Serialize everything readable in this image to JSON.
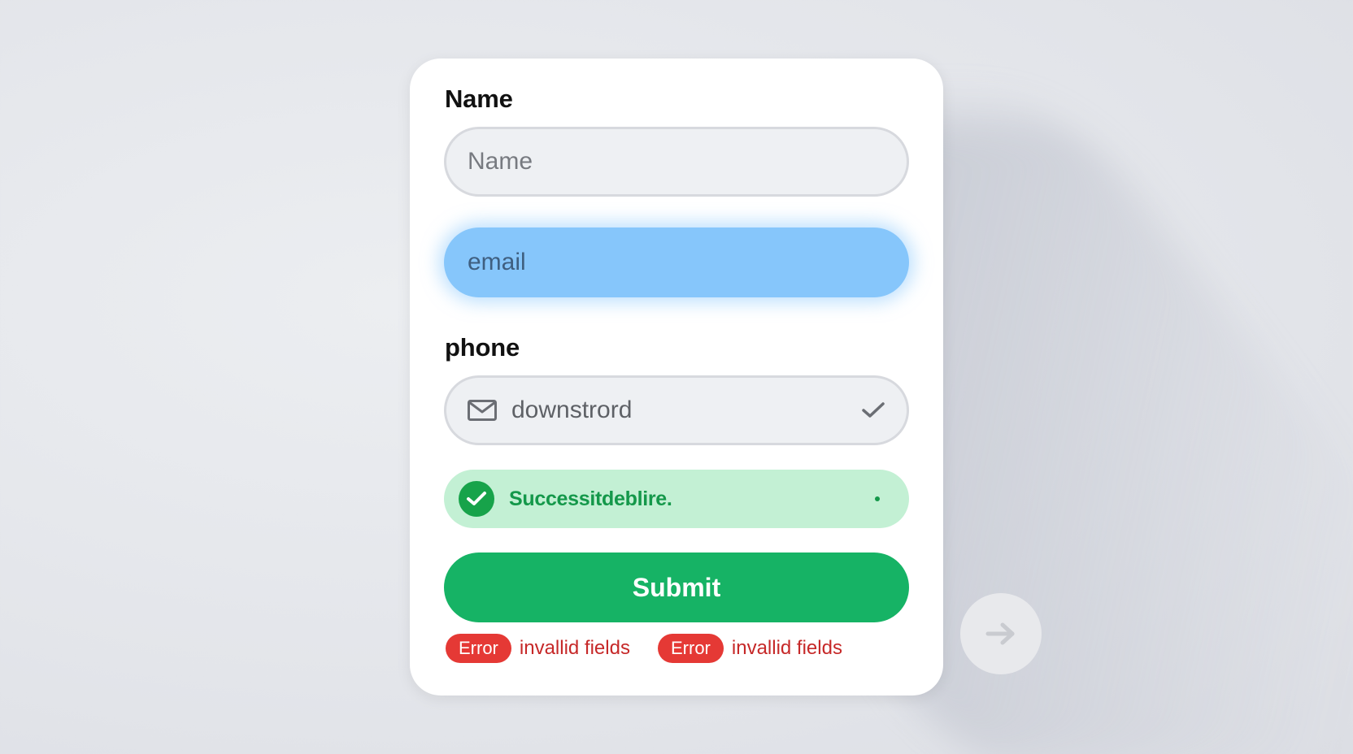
{
  "form": {
    "name_label": "Name",
    "name_placeholder": "Name",
    "email_placeholder": "email",
    "phone_label": "phone",
    "phone_value": "downstrord",
    "success_message": "Successitdeblire.",
    "submit_label": "Submit",
    "errors": [
      {
        "badge": "Error",
        "message": "invallid fields"
      },
      {
        "badge": "Error",
        "message": "invallid fields"
      }
    ]
  },
  "icons": {
    "phone_field_icon": "mail-icon",
    "phone_validation_icon": "check-icon",
    "success_icon": "check-circle-icon",
    "next_icon": "arrow-right-icon"
  },
  "colors": {
    "email_focus": "#86c6fb",
    "success_bg": "#c3f0d4",
    "success_text": "#14984a",
    "submit_bg": "#16b365",
    "error_badge": "#e53935",
    "error_text": "#c62828"
  }
}
